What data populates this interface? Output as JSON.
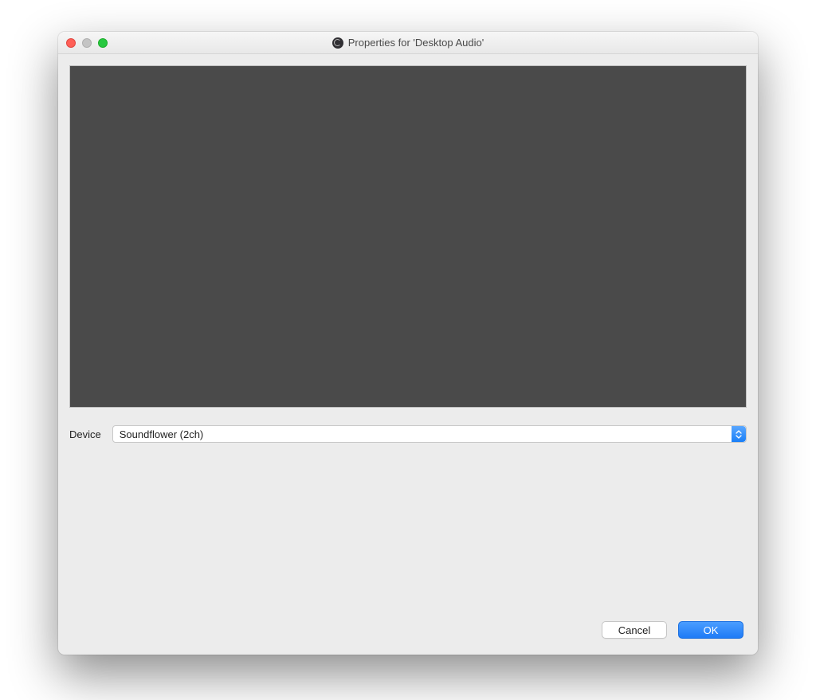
{
  "window": {
    "title": "Properties for 'Desktop Audio'"
  },
  "form": {
    "device_label": "Device",
    "device_value": "Soundflower (2ch)"
  },
  "buttons": {
    "cancel": "Cancel",
    "ok": "OK"
  }
}
